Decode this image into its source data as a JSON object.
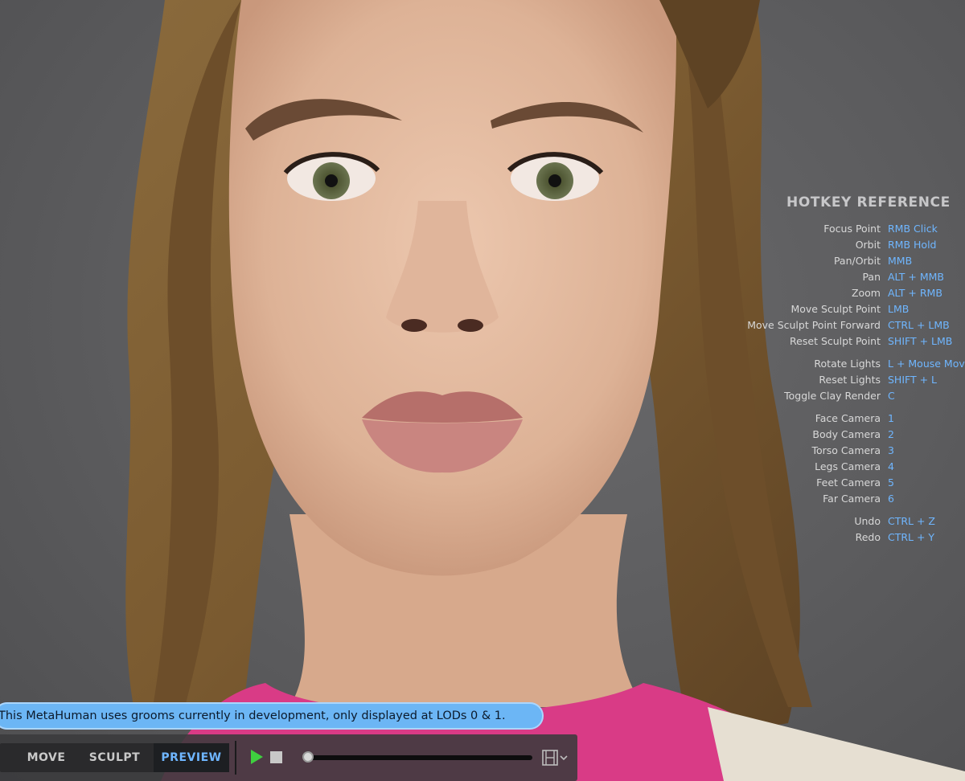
{
  "hotkeys": {
    "title": "HOTKEY REFERENCE",
    "items": [
      {
        "action": "Focus Point",
        "key": "RMB Click"
      },
      {
        "action": "Orbit",
        "key": "RMB Hold"
      },
      {
        "action": "Pan/Orbit",
        "key": "MMB"
      },
      {
        "action": "Pan",
        "key": "ALT + MMB"
      },
      {
        "action": "Zoom",
        "key": "ALT + RMB"
      },
      {
        "action": "Move Sculpt Point",
        "key": "LMB"
      },
      {
        "action": "Move Sculpt Point Forward",
        "key": "CTRL + LMB"
      },
      {
        "action": "Reset Sculpt Point",
        "key": "SHIFT + LMB"
      },
      {
        "action": "Rotate Lights",
        "key": "L + Mouse Move"
      },
      {
        "action": "Reset Lights",
        "key": "SHIFT + L"
      },
      {
        "action": "Toggle Clay Render",
        "key": "C"
      },
      {
        "action": "Face Camera",
        "key": "1"
      },
      {
        "action": "Body Camera",
        "key": "2"
      },
      {
        "action": "Torso Camera",
        "key": "3"
      },
      {
        "action": "Legs Camera",
        "key": "4"
      },
      {
        "action": "Feet Camera",
        "key": "5"
      },
      {
        "action": "Far Camera",
        "key": "6"
      },
      {
        "action": "Undo",
        "key": "CTRL + Z"
      },
      {
        "action": "Redo",
        "key": "CTRL + Y"
      }
    ]
  },
  "notice": {
    "text": "This MetaHuman uses grooms currently in development, only displayed at LODs 0 & 1."
  },
  "toolbar": {
    "modes": [
      "MOVE",
      "SCULPT",
      "PREVIEW"
    ],
    "active_mode": "PREVIEW",
    "timeline_progress": 0
  },
  "colors": {
    "accent": "#6fb6ff",
    "notice_bg": "#6cb6f5",
    "play": "#3fcf3f"
  }
}
